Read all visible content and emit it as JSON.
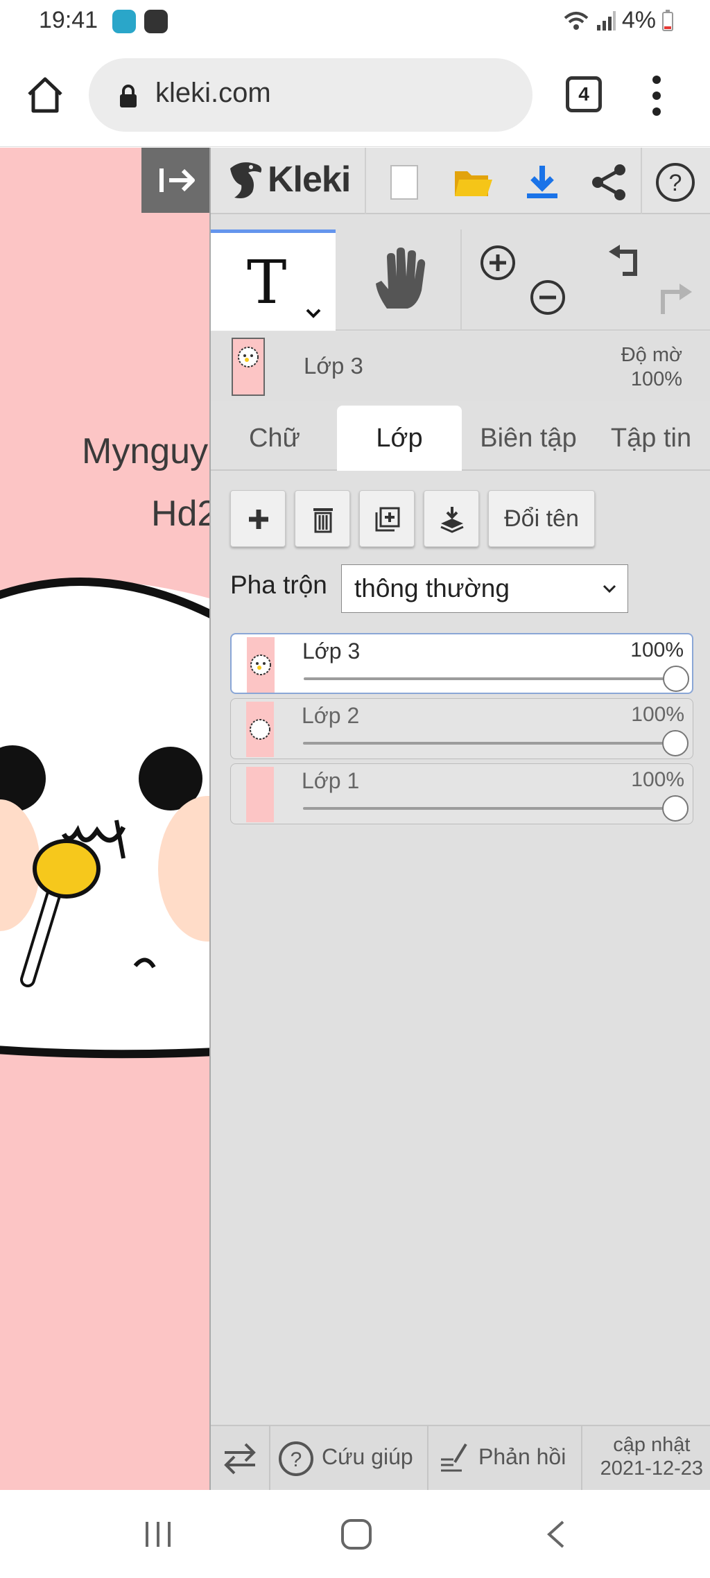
{
  "status_bar": {
    "time": "19:41",
    "battery": "4%",
    "apps": [
      "zalo-pc-icon",
      "zalo-icon"
    ]
  },
  "browser": {
    "url": "kleki.com",
    "tab_count": "4"
  },
  "canvas": {
    "text_line1": "Mynguy",
    "text_line2": "Hd2"
  },
  "app": {
    "logo": "Kleki",
    "active_tool": "T",
    "current_layer": "Lớp 3",
    "opacity_label": "Độ mờ",
    "opacity_value": "100%",
    "tabs": [
      {
        "label": "Chữ",
        "active": false
      },
      {
        "label": "Lớp",
        "active": true
      },
      {
        "label": "Biên tập",
        "active": false
      },
      {
        "label": "Tập tin",
        "active": false
      }
    ],
    "rename_label": "Đổi tên",
    "blend_label": "Pha trộn",
    "blend_mode": "thông thường",
    "layers": [
      {
        "name": "Lớp 3",
        "opacity": "100%",
        "level": 1.0,
        "selected": true
      },
      {
        "name": "Lớp 2",
        "opacity": "100%",
        "level": 1.0,
        "selected": false
      },
      {
        "name": "Lớp 1",
        "opacity": "100%",
        "level": 1.0,
        "selected": false
      }
    ],
    "footer": {
      "help": "Cứu giúp",
      "feedback": "Phản hồi",
      "update_label": "cập nhật",
      "update_date": "2021-12-23"
    }
  },
  "colors": {
    "canvas_bg": "#fcc5c5",
    "panel_bg": "#e0e0e0",
    "accent_blue": "#1a73e8",
    "folder_yellow": "#f5c518"
  }
}
